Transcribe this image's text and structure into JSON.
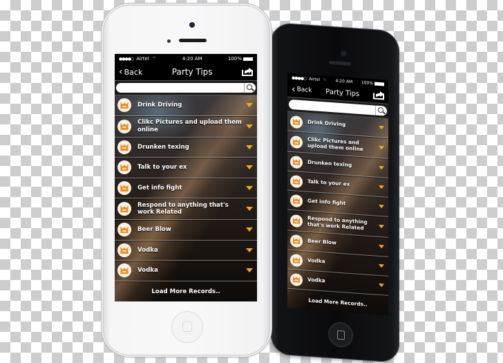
{
  "app": {
    "status_bar": {
      "signal": "●●●●○",
      "carrier": "Airtel",
      "wifi": "wifi-icon",
      "time": "4:20 AM",
      "battery_text": "100%"
    },
    "nav": {
      "back_label": "Back",
      "title": "Party Tips",
      "share_icon": "share-icon"
    },
    "search": {
      "placeholder": "",
      "value": "",
      "icon": "search-icon"
    },
    "items": [
      {
        "label": "Drink Driving",
        "tall": false
      },
      {
        "label": "Clikc Pictures and upload them online",
        "tall": true
      },
      {
        "label": "Drunken texing",
        "tall": false
      },
      {
        "label": "Talk to your ex",
        "tall": false
      },
      {
        "label": "Get info fight",
        "tall": false
      },
      {
        "label": "Respond to anything that's work Related",
        "tall": true
      },
      {
        "label": "Beer Blow",
        "tall": false
      },
      {
        "label": "Vodka",
        "tall": false
      },
      {
        "label": "Vodka",
        "tall": false
      }
    ],
    "load_more": "Load More Records..",
    "colors": {
      "accent": "#f2a71e",
      "avatar_mask": "#f18a1c"
    }
  }
}
